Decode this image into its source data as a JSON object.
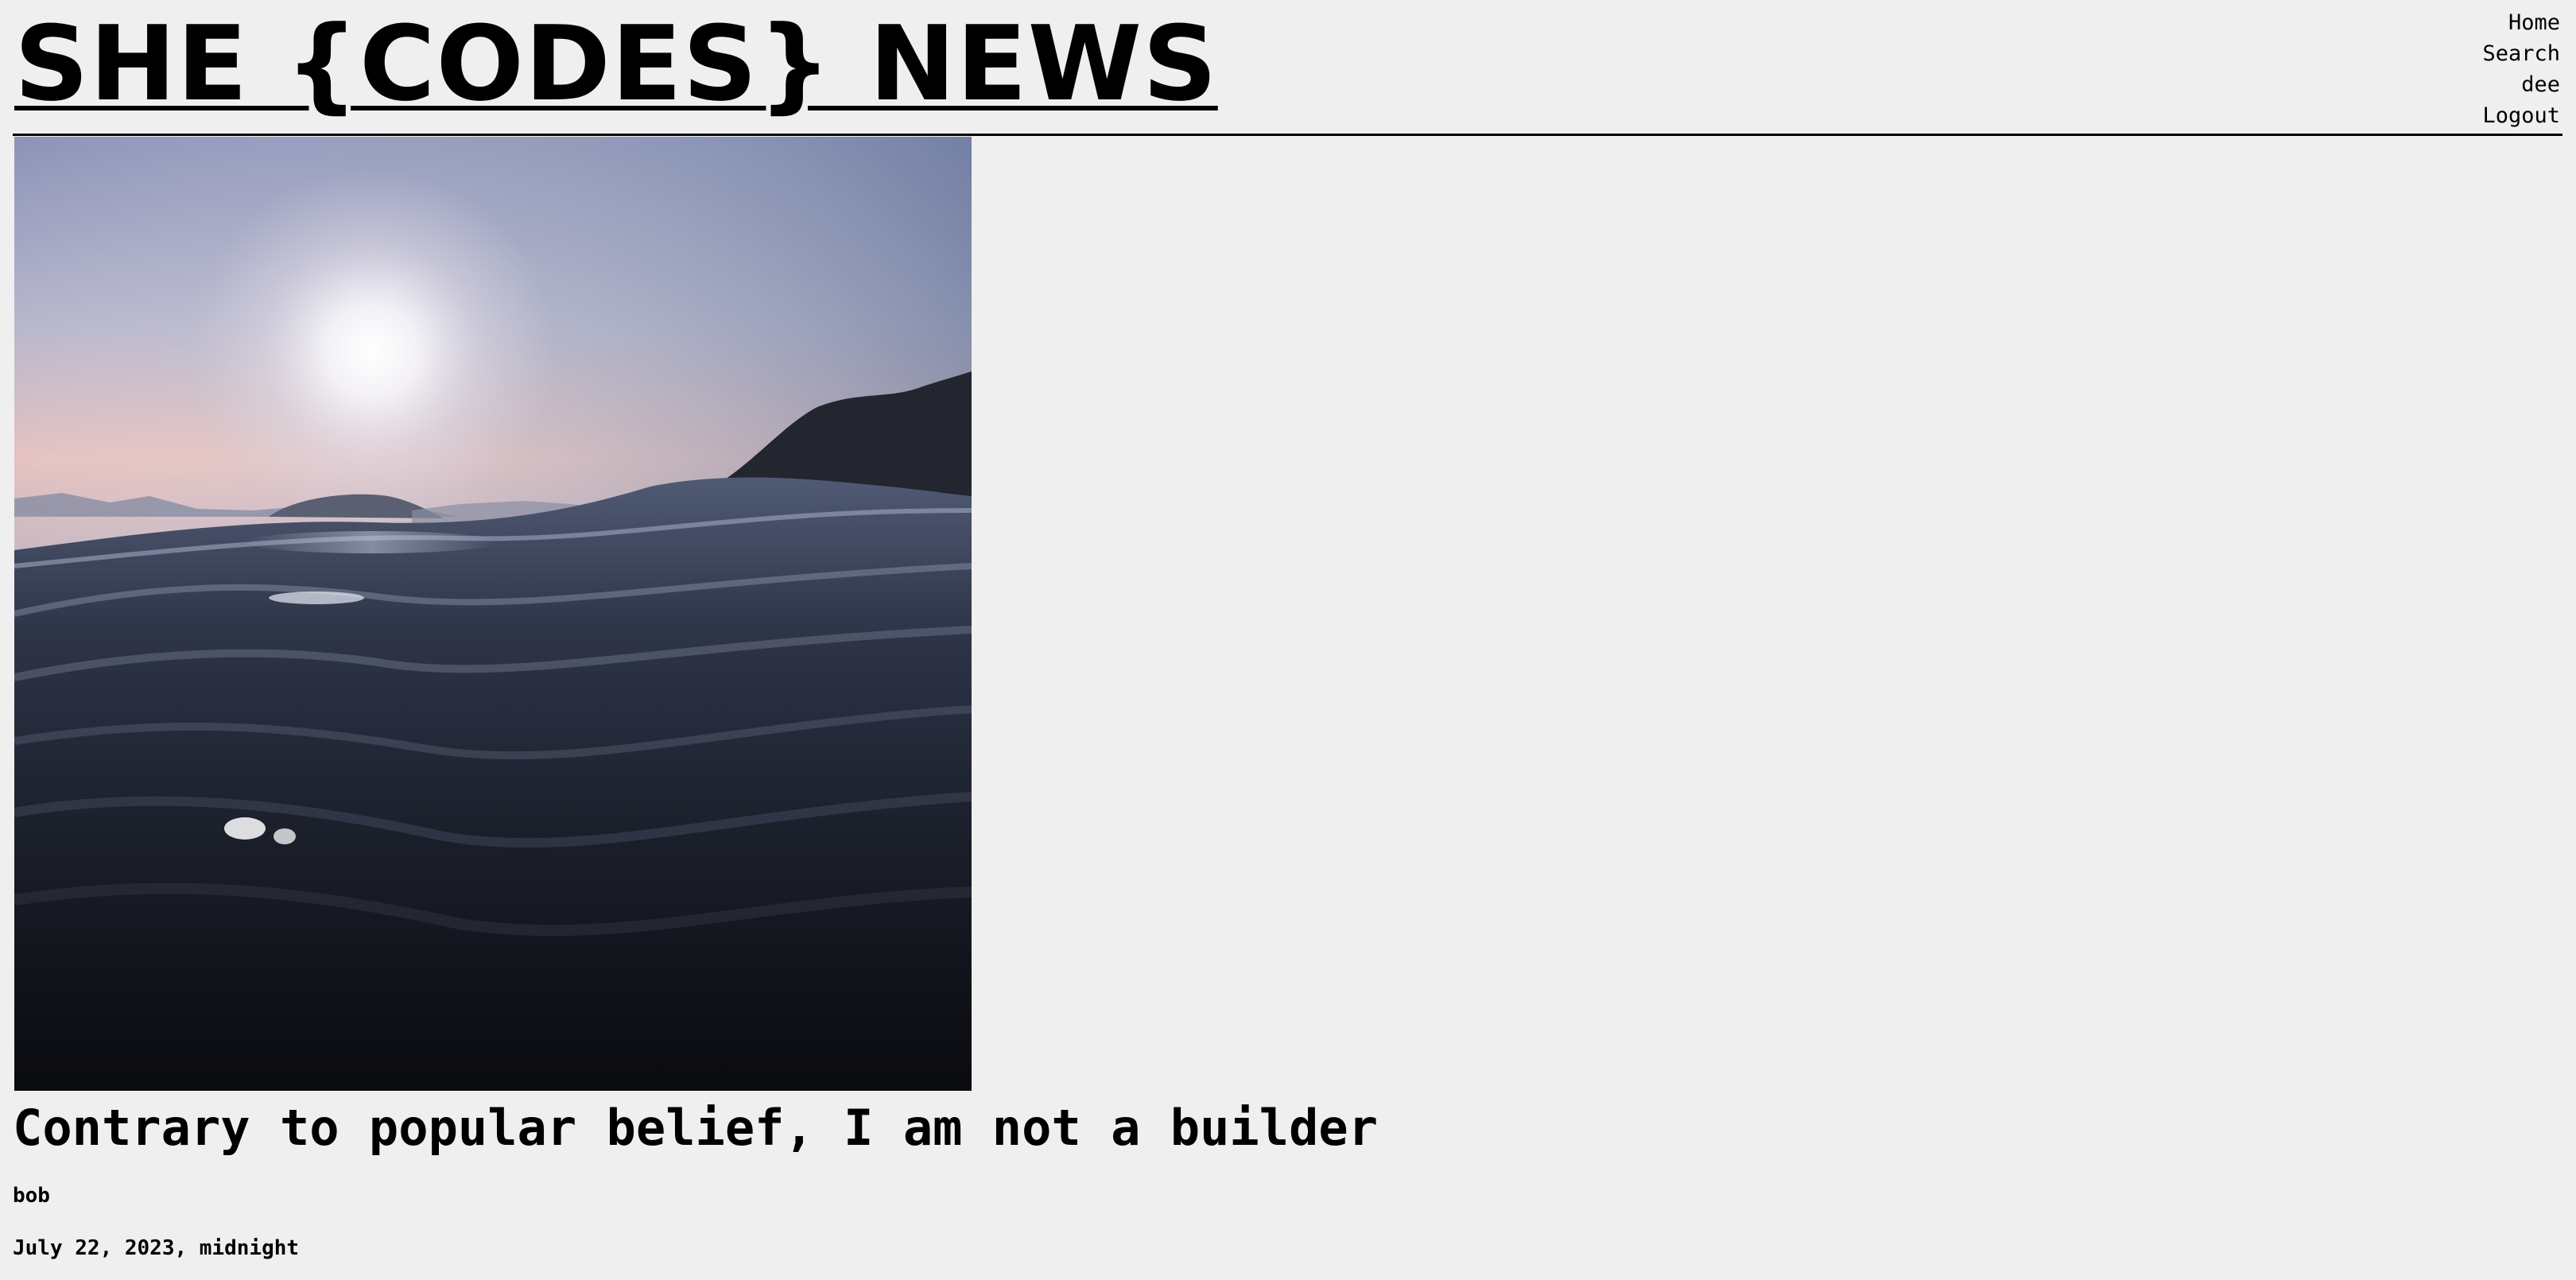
{
  "header": {
    "site_title": "SHE {CODES} NEWS",
    "nav": [
      {
        "label": "Home"
      },
      {
        "label": "Search"
      },
      {
        "label": "dee"
      },
      {
        "label": "Logout"
      }
    ]
  },
  "article": {
    "image_description": "ocean-waves-at-sunset",
    "title": "Contrary to popular belief, I am not a builder",
    "author": "bob",
    "date": "July 22, 2023, midnight"
  },
  "colors": {
    "background": "#efefef",
    "text": "#000000",
    "rule": "#000000"
  }
}
